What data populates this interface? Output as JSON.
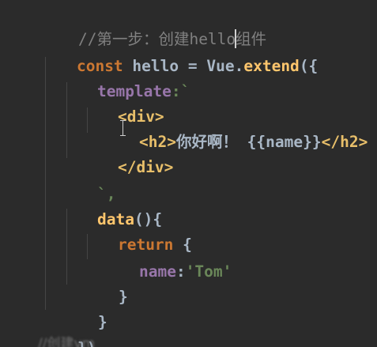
{
  "comment_line": {
    "before_caret": "//第一步：创建hello",
    "after_caret": "组件"
  },
  "code": {
    "l1_kw": "const",
    "l1_name": "hello",
    "l1_eq": "=",
    "l1_obj": "Vue",
    "l1_dot": ".",
    "l1_fn": "extend",
    "l1_paren": "({",
    "l2_prop": "template",
    "l2_colon": ":`",
    "l3_tag": "<div>",
    "l4_tag_open": "<h2>",
    "l4_text": "你好啊！ {{name}}",
    "l4_tag_close": "</h2>",
    "l5_tag": "</div>",
    "l6_text": "`,",
    "l7_fn": "data",
    "l7_paren": "(){",
    "l8_kw": "return",
    "l8_brace": "{",
    "l9_prop": "name",
    "l9_colon": ":",
    "l9_str": "'Tom'",
    "l10_brace": "}",
    "l11_brace": "}",
    "l12_close": "})",
    "l13_partial": "//创建vm"
  },
  "colors": {
    "background": "#2b2b2b",
    "comment": "#808080",
    "keyword": "#cc7832",
    "function": "#ffc66d",
    "string": "#6a8759",
    "tag": "#e8bf6a",
    "default": "#a9b7c6"
  }
}
